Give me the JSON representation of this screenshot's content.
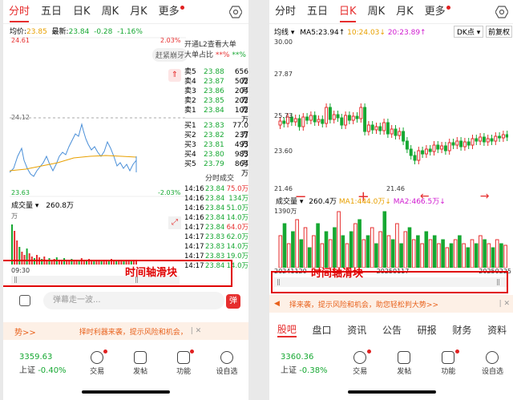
{
  "left": {
    "tabs": [
      "分时",
      "五日",
      "日K",
      "周K",
      "月K",
      "更多"
    ],
    "info": {
      "avg_label": "均价:",
      "avg": "23.85",
      "last_label": "最新:",
      "last": "23.84",
      "chg": "-0.28",
      "pct": "-1.16%"
    },
    "axis": {
      "top": "24.61",
      "mid": "24.12",
      "bottom": "23.63",
      "pct_top": "2.03%",
      "pct_bottom": "-2.03%"
    },
    "chase_tag": "赶紧崩牙",
    "l2": {
      "line1": "开通L2查看大单",
      "line2": "大单占比",
      "v1": "**%",
      "v2": "**%"
    },
    "asks": [
      [
        "卖5",
        "23.88",
        "656万"
      ],
      [
        "卖4",
        "23.87",
        "502万"
      ],
      [
        "卖3",
        "23.86",
        "204万"
      ],
      [
        "卖2",
        "23.85",
        "202万"
      ],
      [
        "卖1",
        "23.84",
        "102万"
      ]
    ],
    "bids": [
      [
        "买1",
        "23.83",
        "77.0万"
      ],
      [
        "买2",
        "23.82",
        "237万"
      ],
      [
        "买3",
        "23.81",
        "493万"
      ],
      [
        "买4",
        "23.80",
        "983万"
      ],
      [
        "买5",
        "23.79",
        "864万"
      ]
    ],
    "trades_title": "分时成交",
    "trades": [
      [
        "14:16",
        "23.84",
        "75.0万"
      ],
      [
        "14:16",
        "23.84",
        "134万"
      ],
      [
        "14:16",
        "23.84",
        "51.0万"
      ],
      [
        "14:16",
        "23.84",
        "14.0万"
      ],
      [
        "14:17",
        "23.84",
        "64.0万"
      ],
      [
        "14:17",
        "23.83",
        "62.0万"
      ],
      [
        "14:17",
        "23.83",
        "14.0万"
      ],
      [
        "14:17",
        "23.83",
        "19.0万"
      ],
      [
        "14:17",
        "23.84",
        "14.0万"
      ]
    ],
    "vol_label": "成交量",
    "vol_value": "260.8万",
    "vol_axis": "万",
    "time_start": "09:30",
    "annotation": "时间轴滑块",
    "comment_placeholder": "弹幕走一波...",
    "danmu_btn": "弹",
    "banner_left": "势>>",
    "banner_right": "择时利器来袭，提示风险和机会，",
    "index_value": "3359.63",
    "index_name": "上证",
    "index_pct": "-0.40%",
    "nav": [
      "交易",
      "发帖",
      "功能",
      "设自选"
    ]
  },
  "right": {
    "tabs": [
      "分时",
      "五日",
      "日K",
      "周K",
      "月K",
      "更多"
    ],
    "ma_line": {
      "label": "均线",
      "ma5": "MA5:23.94↑",
      "ma10": "10:24.03↓",
      "ma20": "20:23.89↑",
      "dk": "DK点",
      "fq": "前复权"
    },
    "axis": {
      "top": "30.00",
      "a2": "27.87",
      "a3": "25.73",
      "a4": "23.60",
      "bottom": "21.46",
      "low_label": "21.46"
    },
    "vol_label": "成交量",
    "vol_value": "260.4万",
    "ma1": "MA1:444.0万↓",
    "ma2": "MA2:466.5万↓",
    "vol_top": "1390万",
    "dates": [
      "20241120",
      "20250117",
      "20250225"
    ],
    "annotation": "时间轴滑块",
    "banner": "择来袭，提示风险和机会，助您轻松判大势>>",
    "sub_tabs": [
      "股吧",
      "盘口",
      "资讯",
      "公告",
      "研报",
      "财务",
      "资料"
    ],
    "index_value": "3360.36",
    "index_name": "上证",
    "index_pct": "-0.38%",
    "nav": [
      "交易",
      "发帖",
      "功能",
      "设自选"
    ]
  }
}
